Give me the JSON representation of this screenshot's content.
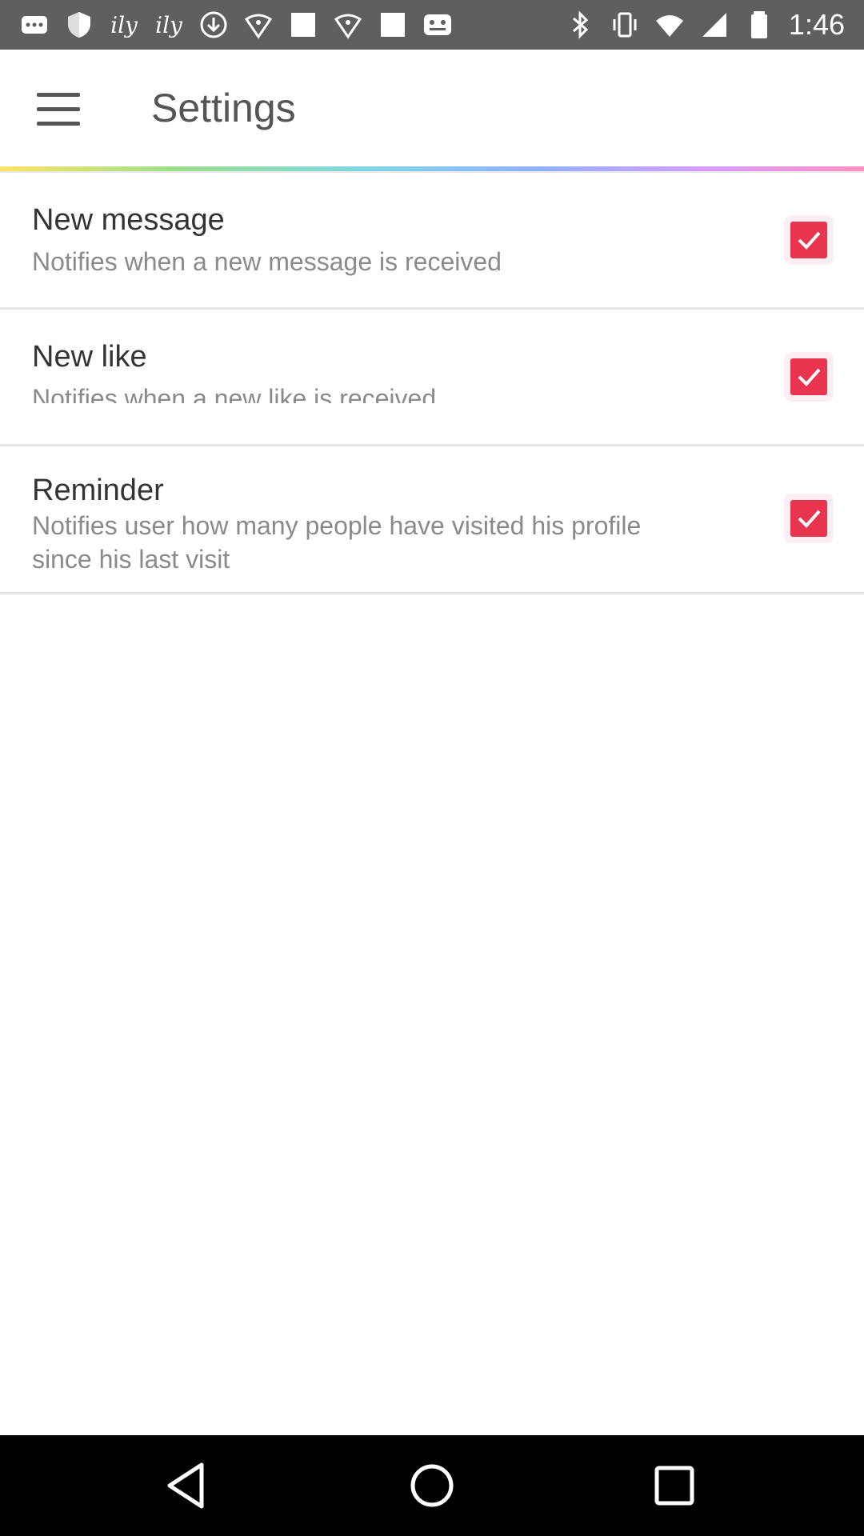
{
  "status_bar": {
    "time": "1:46",
    "left_icons": [
      "more-icon",
      "shield-icon",
      "ily-text-icon",
      "ily-text-icon",
      "download-icon",
      "lightbulb-icon",
      "blank-card-icon",
      "lightbulb-icon",
      "blank-card-icon",
      "chat-faces-icon"
    ],
    "ily_label_1": "ily",
    "ily_label_2": "ily",
    "right_icons": [
      "bluetooth-icon",
      "vibrate-icon",
      "wifi-icon",
      "signal-icon",
      "battery-icon"
    ]
  },
  "app_bar": {
    "title": "Settings",
    "menu_icon": "menu-icon"
  },
  "settings": [
    {
      "title": "New message",
      "subtitle": "Notifies when a new message is received",
      "checked": true
    },
    {
      "title": "New like",
      "subtitle": "Notifies when a new like is received",
      "checked": true
    },
    {
      "title": "Reminder",
      "subtitle_line1": "Notifies user how many people have visited his profile",
      "subtitle_line2": "since his last visit",
      "checked": true
    }
  ],
  "colors": {
    "checkbox": "#e8344e",
    "status_bar": "#5f5f5f",
    "nav_bar": "#000000"
  },
  "nav_bar": {
    "buttons": [
      "back-icon",
      "home-icon",
      "recents-icon"
    ]
  }
}
